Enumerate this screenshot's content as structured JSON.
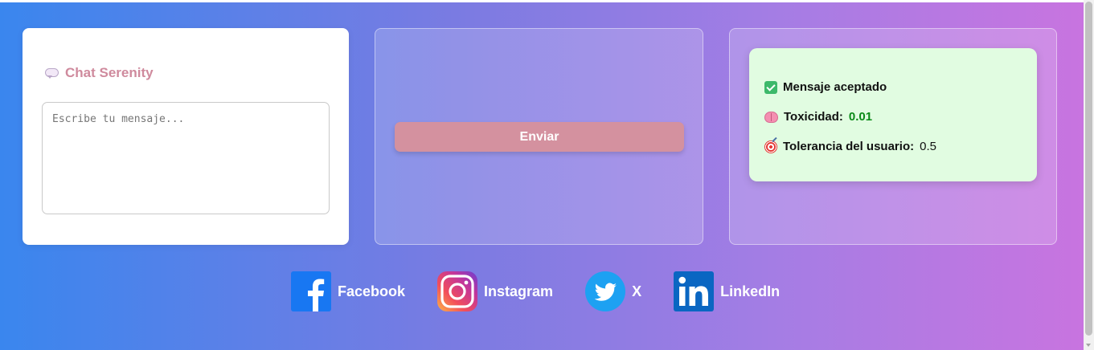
{
  "chat": {
    "title": "Chat Serenity",
    "title_icon": "speech-bubble-icon",
    "input_placeholder": "Escribe tu mensaje...",
    "input_value": ""
  },
  "send": {
    "button_label": "Enviar"
  },
  "result": {
    "status_label": "Mensaje aceptado",
    "toxicity_label": "Toxicidad:",
    "toxicity_value": "0.01",
    "tolerance_label": "Tolerancia del usuario:",
    "tolerance_value": "0.5",
    "status_color": "#0a8a17"
  },
  "social": [
    {
      "label": "Facebook",
      "icon": "facebook-icon",
      "color": "#1877f2"
    },
    {
      "label": "Instagram",
      "icon": "instagram-icon",
      "color": "#e1306c"
    },
    {
      "label": "X",
      "icon": "twitter-icon",
      "color": "#1da1f2"
    },
    {
      "label": "LinkedIn",
      "icon": "linkedin-icon",
      "color": "#0a66c2"
    }
  ],
  "theme": {
    "gradient_start": "#3a86ee",
    "gradient_end": "#c874e0",
    "accent": "#d4919f"
  }
}
